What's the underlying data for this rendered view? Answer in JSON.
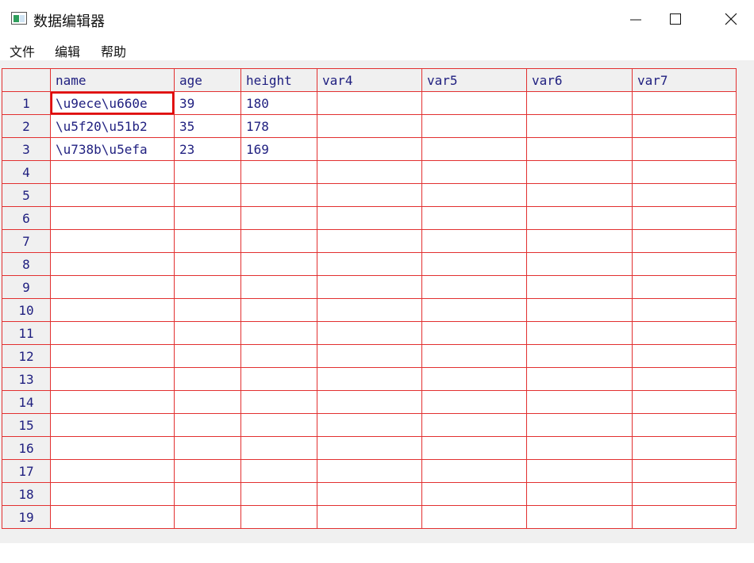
{
  "window": {
    "title": "数据编辑器",
    "icon": "data-editor-icon",
    "controls": [
      "minimize-icon",
      "maximize-icon",
      "close-icon"
    ]
  },
  "menu": {
    "items": [
      "文件",
      "编辑",
      "帮助"
    ]
  },
  "grid": {
    "columns": [
      "name",
      "age",
      "height",
      "var4",
      "var5",
      "var6",
      "var7"
    ],
    "rows": [
      {
        "n": "1",
        "cells": [
          "\\u9ece\\u660e",
          "39",
          "180",
          "",
          "",
          "",
          ""
        ]
      },
      {
        "n": "2",
        "cells": [
          "\\u5f20\\u51b2",
          "35",
          "178",
          "",
          "",
          "",
          ""
        ]
      },
      {
        "n": "3",
        "cells": [
          "\\u738b\\u5efa",
          "23",
          "169",
          "",
          "",
          "",
          ""
        ]
      },
      {
        "n": "4",
        "cells": [
          "",
          "",
          "",
          "",
          "",
          "",
          ""
        ]
      },
      {
        "n": "5",
        "cells": [
          "",
          "",
          "",
          "",
          "",
          "",
          ""
        ]
      },
      {
        "n": "6",
        "cells": [
          "",
          "",
          "",
          "",
          "",
          "",
          ""
        ]
      },
      {
        "n": "7",
        "cells": [
          "",
          "",
          "",
          "",
          "",
          "",
          ""
        ]
      },
      {
        "n": "8",
        "cells": [
          "",
          "",
          "",
          "",
          "",
          "",
          ""
        ]
      },
      {
        "n": "9",
        "cells": [
          "",
          "",
          "",
          "",
          "",
          "",
          ""
        ]
      },
      {
        "n": "10",
        "cells": [
          "",
          "",
          "",
          "",
          "",
          "",
          ""
        ]
      },
      {
        "n": "11",
        "cells": [
          "",
          "",
          "",
          "",
          "",
          "",
          ""
        ]
      },
      {
        "n": "12",
        "cells": [
          "",
          "",
          "",
          "",
          "",
          "",
          ""
        ]
      },
      {
        "n": "13",
        "cells": [
          "",
          "",
          "",
          "",
          "",
          "",
          ""
        ]
      },
      {
        "n": "14",
        "cells": [
          "",
          "",
          "",
          "",
          "",
          "",
          ""
        ]
      },
      {
        "n": "15",
        "cells": [
          "",
          "",
          "",
          "",
          "",
          "",
          ""
        ]
      },
      {
        "n": "16",
        "cells": [
          "",
          "",
          "",
          "",
          "",
          "",
          ""
        ]
      },
      {
        "n": "17",
        "cells": [
          "",
          "",
          "",
          "",
          "",
          "",
          ""
        ]
      },
      {
        "n": "18",
        "cells": [
          "",
          "",
          "",
          "",
          "",
          "",
          ""
        ]
      },
      {
        "n": "19",
        "cells": [
          "",
          "",
          "",
          "",
          "",
          "",
          ""
        ]
      }
    ],
    "selected": {
      "row": 1,
      "column": "name"
    }
  },
  "colors": {
    "grid_line": "#e23030",
    "text": "#202080",
    "selection": "#e00000",
    "header_bg": "#f0f0f0"
  }
}
